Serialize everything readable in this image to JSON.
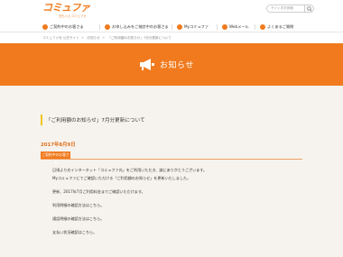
{
  "header": {
    "logo": "コミュファ",
    "logo_sub": "光もっとコミュファ",
    "search_placeholder": "サイト内を検索"
  },
  "nav": {
    "items": [
      {
        "label": "ご契約中のお客さま"
      },
      {
        "label": "お申し込みをご検討中のお客さま"
      },
      {
        "label": "Myコミュファ"
      },
      {
        "label": "Webメール"
      },
      {
        "label": "よくあるご質問"
      }
    ]
  },
  "breadcrumb": [
    "コミュファ光 公式サイト",
    "お知らせ",
    "「ご利用額のお知らせ」7月分更新について"
  ],
  "banner": {
    "title": "お知らせ"
  },
  "article": {
    "heading": "「ご利用額のお知らせ」7月分更新について",
    "date": "2017年8月9日",
    "tag": "ご契約中のお客さま",
    "paragraphs": [
      "日頃より光インターネット「コミュファ光」をご利用いただき、誠にありがとうございます。",
      "Myコミュファにてご確認いただける「ご利用額のお知らせ」を更新いたしました。",
      "",
      "更新、2017年7月ご利用料金までご確認いただけます。",
      "",
      "利用明細の確認方法はこちら。",
      "",
      "通話明細の確認方法はこちら。",
      "",
      "支払い状況確認はこちら。"
    ]
  },
  "colors": {
    "accent": "#f07a1d",
    "heading_rule": "#f0c419",
    "background": "#f6f3ee"
  }
}
